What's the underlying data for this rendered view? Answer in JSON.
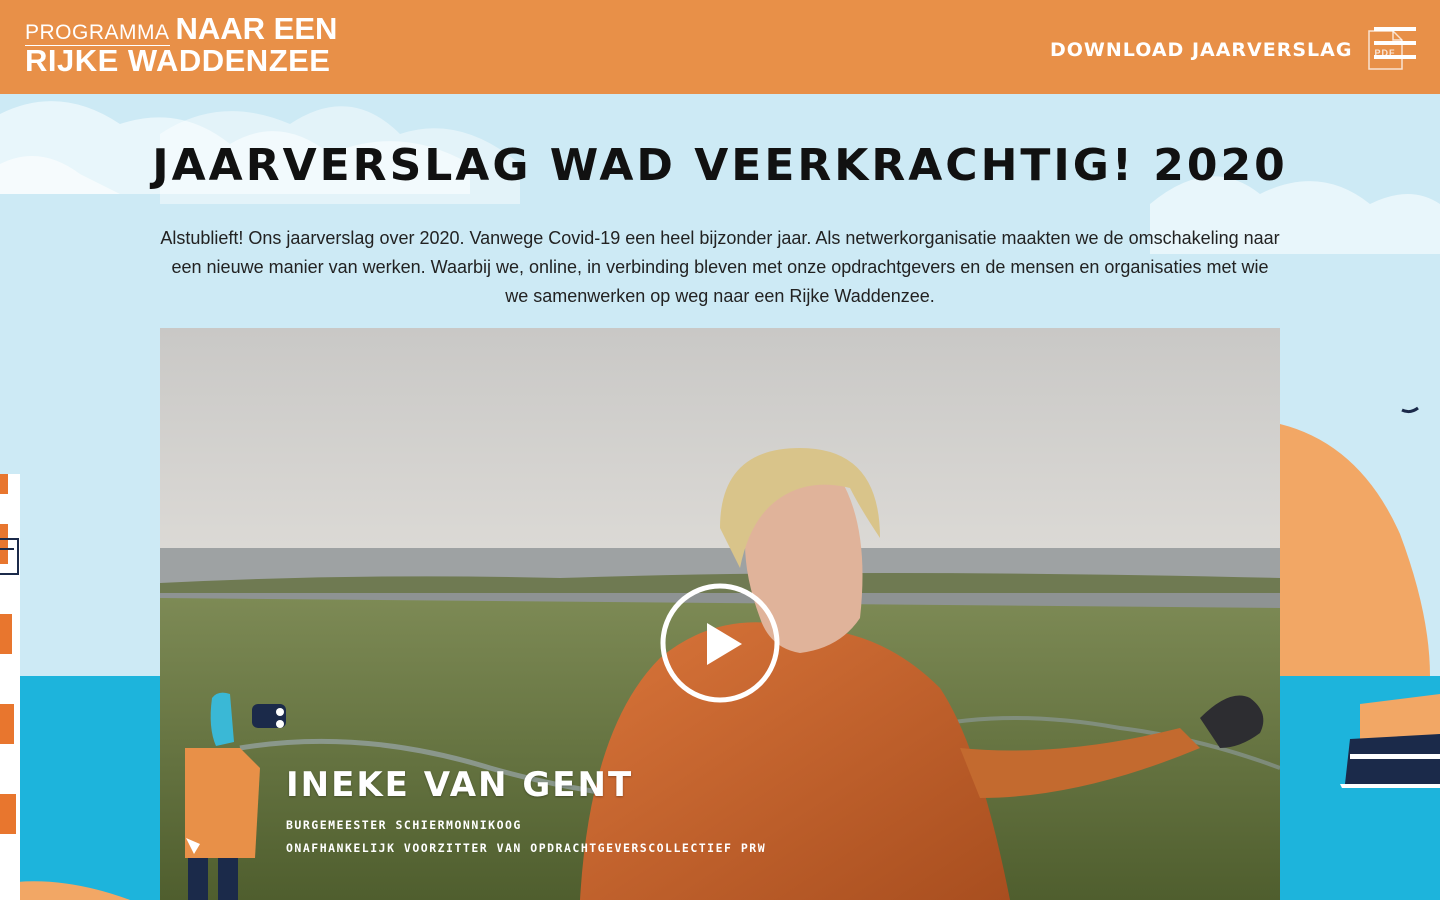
{
  "header": {
    "logo_small": "PROGRAMMA",
    "logo_line1": "NAAR EEN",
    "logo_line2": "RIJKE WADDENZEE",
    "download_label": "Download jaarverslag",
    "pdf_icon": "pdf-file-icon",
    "menu_icon": "hamburger-menu-icon"
  },
  "main": {
    "title": "Jaarverslag Wad Veerkrachtig! 2020",
    "intro": "Alstublieft! Ons jaarverslag over 2020. Vanwege Covid-19 een heel bijzonder jaar. Als netwerkorganisatie maakten we de omschakeling naar een nieuwe manier van werken. Waarbij we, online, in verbinding bleven met onze opdrachtgevers en de mensen en organisaties met wie we samenwerken op weg naar een Rijke Waddenzee."
  },
  "video": {
    "play_icon": "play-icon",
    "caption_name": "Ineke van Gent",
    "caption_role1": "Burgemeester Schiermonnikoog",
    "caption_role2": "Onafhankelijk voorzitter van Opdrachtgeverscollectief PRW"
  },
  "colors": {
    "header_bg": "#e89048",
    "sky": "#cdeaf5",
    "sea": "#1db4dc",
    "dune": "#f2a765"
  }
}
